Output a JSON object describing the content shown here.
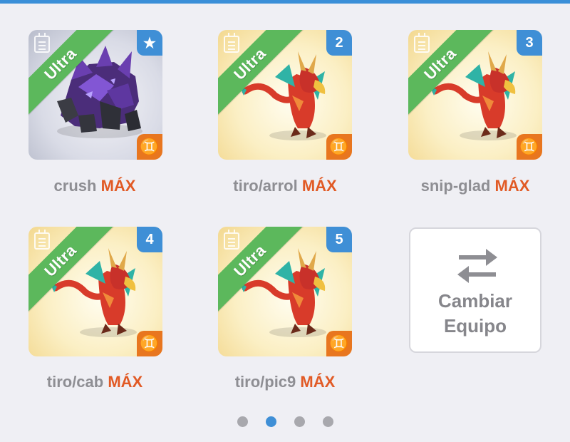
{
  "cards": [
    {
      "name": "crush",
      "level": "MÁX",
      "rarity": "Ultra",
      "badge": "★",
      "element_icon": "gemini-symbol-icon",
      "style": "gray"
    },
    {
      "name": "tiro/arrol",
      "level": "MÁX",
      "rarity": "Ultra",
      "badge": "2",
      "element_icon": "gemini-symbol-icon",
      "style": "gold"
    },
    {
      "name": "snip-glad",
      "level": "MÁX",
      "rarity": "Ultra",
      "badge": "3",
      "element_icon": "gemini-symbol-icon",
      "style": "gold"
    },
    {
      "name": "tiro/cab",
      "level": "MÁX",
      "rarity": "Ultra",
      "badge": "4",
      "element_icon": "gemini-symbol-icon",
      "style": "gold"
    },
    {
      "name": "tiro/pic9",
      "level": "MÁX",
      "rarity": "Ultra",
      "badge": "5",
      "element_icon": "gemini-symbol-icon",
      "style": "gold"
    }
  ],
  "swap_button": {
    "line1": "Cambiar",
    "line2": "Equipo",
    "icon": "swap-arrows-icon"
  },
  "element_glyph": "♊",
  "pagination": {
    "total": 4,
    "active_index": 1
  },
  "colors": {
    "accent": "#3f8fd6",
    "ribbon": "#5cb85c",
    "max_level": "#e15a25",
    "element_badge": "#e8761f"
  }
}
